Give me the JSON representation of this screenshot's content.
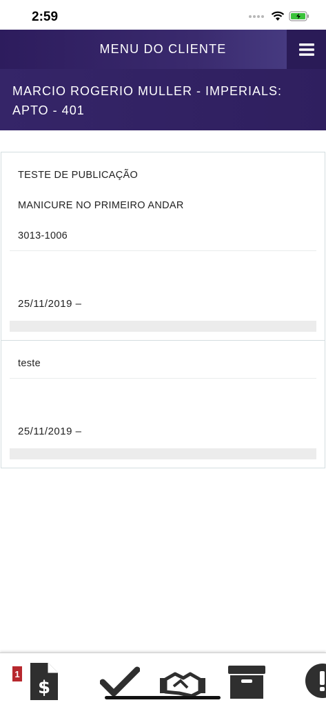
{
  "status": {
    "time": "2:59"
  },
  "header": {
    "title": "MENU DO CLIENTE"
  },
  "client": {
    "name": "MARCIO ROGERIO MULLER - IMPERIALS: APTO - 401"
  },
  "posts": [
    {
      "lines": [
        "TESTE DE PUBLICAÇÃO",
        "MANICURE NO PRIMEIRO ANDAR",
        "3013-1006"
      ],
      "date": "25/11/2019 –"
    },
    {
      "lines": [
        "teste"
      ],
      "date": "25/11/2019 –"
    }
  ],
  "bottom_nav": {
    "badge_count": "1",
    "items": [
      "invoice-icon",
      "check-icon",
      "handshake-icon",
      "archive-icon",
      "alert-icon"
    ]
  }
}
